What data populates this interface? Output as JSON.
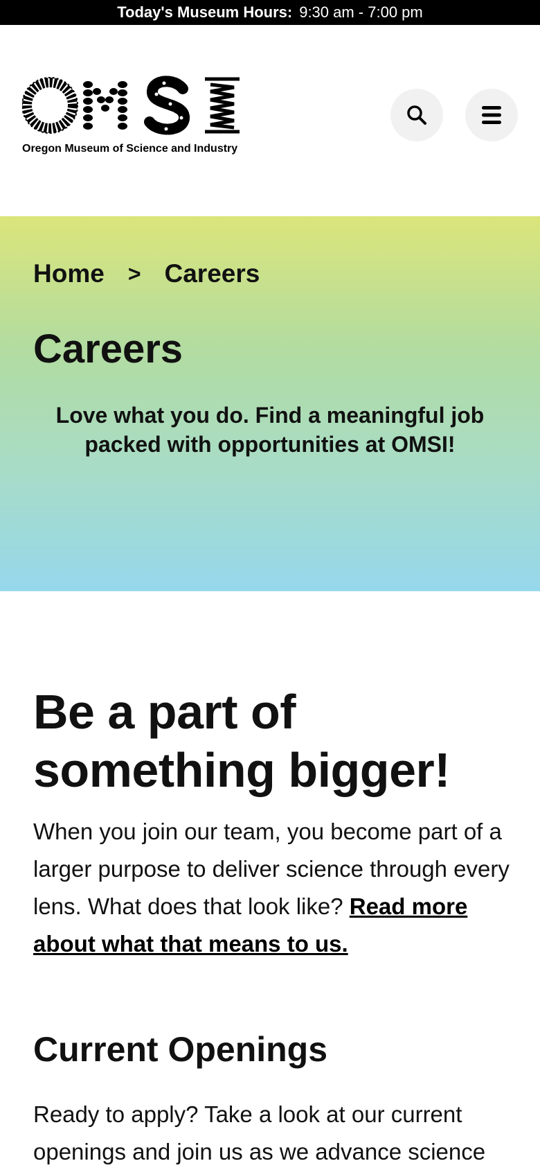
{
  "hours_bar": {
    "label": "Today's Museum Hours:",
    "value": "9:30 am - 7:00 pm"
  },
  "header": {
    "logo_text": "OMSI",
    "logo_subtitle": "Oregon Museum of Science and Industry",
    "search_icon": "search-icon",
    "menu_icon": "hamburger-menu-icon"
  },
  "hero": {
    "breadcrumb": {
      "home": "Home",
      "separator": ">",
      "current": "Careers"
    },
    "title": "Careers",
    "subtitle": "Love what you do. Find a meaningful job packed with opportunities at OMSI!"
  },
  "content": {
    "heading": "Be a part of something bigger!",
    "intro_text": "When you join our team, you become part of a larger purpose to deliver science through every lens. What does that look like? ",
    "intro_link": "Read more about what that means to us.",
    "openings_heading": "Current Openings",
    "openings_text": "Ready to apply? Take a look at our current openings and join us as we advance science"
  },
  "colors": {
    "top_bar": "#000000",
    "hero_gradient_top": "#dbe57a",
    "hero_gradient_bottom": "#96d8ec",
    "icon_button_bg": "#f1f1f1"
  }
}
